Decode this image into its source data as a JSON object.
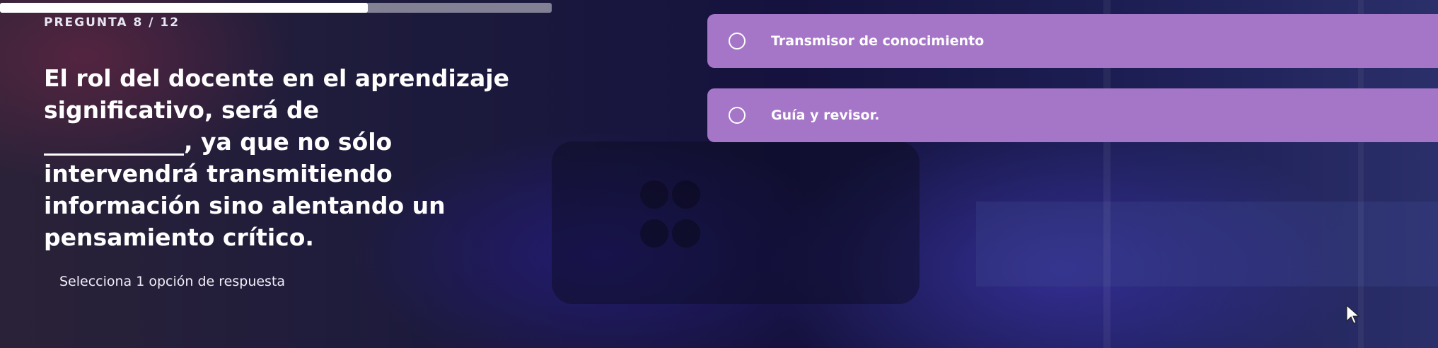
{
  "quiz": {
    "counter": "PREGUNTA 8 / 12",
    "progress": 0.667,
    "question_line1": "El rol del docente en el aprendizaje",
    "question_line2": "significativo, será de",
    "question_line3": "____________, ya que no sólo",
    "question_line4": "intervendrá transmitiendo",
    "question_line5": "información sino alentando un",
    "question_line6": "pensamiento crítico.",
    "instruction": "Selecciona 1 opción de respuesta"
  },
  "options": [
    {
      "label": "Transmisor de conocimiento"
    },
    {
      "label": "Guía y revisor."
    }
  ],
  "colors": {
    "option_background": "#a575c8",
    "text": "#ffffff"
  },
  "icons": {
    "radio": "radio-circle-icon",
    "pointer": "mouse-pointer-icon"
  }
}
